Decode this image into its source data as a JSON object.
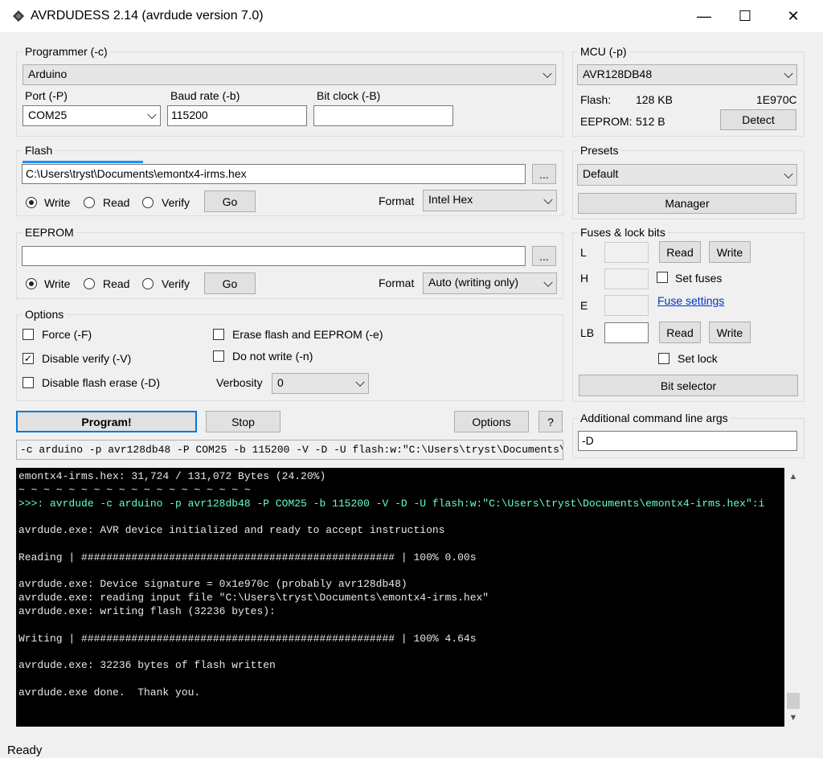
{
  "window": {
    "title": "AVRDUDESS 2.14 (avrdude version 7.0)",
    "minimize": "—",
    "maximize": "☐",
    "close": "✕"
  },
  "programmer": {
    "group_label": "Programmer (-c)",
    "selected": "Arduino",
    "port_label": "Port (-P)",
    "port_value": "COM25",
    "baud_label": "Baud rate (-b)",
    "baud_value": "115200",
    "bitclock_label": "Bit clock (-B)",
    "bitclock_value": ""
  },
  "mcu": {
    "group_label": "MCU (-p)",
    "selected": "AVR128DB48",
    "flash_label": "Flash:",
    "flash_value": "128 KB",
    "signature": "1E970C",
    "eeprom_label": "EEPROM:",
    "eeprom_value": "512 B",
    "detect_button": "Detect"
  },
  "flash": {
    "group_label": "Flash",
    "file": "C:\\Users\\tryst\\Documents\\emontx4-irms.hex",
    "browse": "...",
    "write": "Write",
    "read": "Read",
    "verify": "Verify",
    "go": "Go",
    "format_label": "Format",
    "format_value": "Intel Hex",
    "progress": 0.25
  },
  "eeprom": {
    "group_label": "EEPROM",
    "file": "",
    "browse": "...",
    "write": "Write",
    "read": "Read",
    "verify": "Verify",
    "go": "Go",
    "format_label": "Format",
    "format_value": "Auto (writing only)"
  },
  "presets": {
    "group_label": "Presets",
    "selected": "Default",
    "manager_button": "Manager"
  },
  "fuses": {
    "group_label": "Fuses & lock bits",
    "l_label": "L",
    "h_label": "H",
    "e_label": "E",
    "lb_label": "LB",
    "read": "Read",
    "write": "Write",
    "set_fuses": "Set fuses",
    "fuse_settings_link": "Fuse settings",
    "set_lock": "Set lock",
    "bit_selector": "Bit selector"
  },
  "options": {
    "group_label": "Options",
    "force": "Force (-F)",
    "disable_verify": "Disable verify (-V)",
    "disable_flash_erase": "Disable flash erase (-D)",
    "erase_flash": "Erase flash and EEPROM (-e)",
    "do_not_write": "Do not write (-n)",
    "verbosity_label": "Verbosity",
    "verbosity_value": "0",
    "disable_verify_checked": "✓"
  },
  "actions": {
    "program": "Program!",
    "stop": "Stop",
    "options": "Options",
    "help": "?"
  },
  "additional_args": {
    "label": "Additional command line args",
    "value": "-D"
  },
  "command_line": "-c arduino -p avr128db48 -P COM25 -b 115200 -V -D -U flash:w:\"C:\\Users\\tryst\\Documents\\e",
  "console": [
    "emontx4-irms.hex: 31,724 / 131,072 Bytes (24.20%)",
    "~ ~ ~ ~ ~ ~ ~ ~ ~ ~ ~ ~ ~ ~ ~ ~ ~ ~ ~",
    ">>>: avrdude -c arduino -p avr128db48 -P COM25 -b 115200 -V -D -U flash:w:\"C:\\Users\\tryst\\Documents\\emontx4-irms.hex\":i",
    "",
    "avrdude.exe: AVR device initialized and ready to accept instructions",
    "",
    "Reading | ################################################## | 100% 0.00s",
    "",
    "avrdude.exe: Device signature = 0x1e970c (probably avr128db48)",
    "avrdude.exe: reading input file \"C:\\Users\\tryst\\Documents\\emontx4-irms.hex\"",
    "avrdude.exe: writing flash (32236 bytes):",
    "",
    "Writing | ################################################## | 100% 4.64s",
    "",
    "avrdude.exe: 32236 bytes of flash written",
    "",
    "avrdude.exe done.  Thank you.",
    ""
  ],
  "status": "Ready"
}
